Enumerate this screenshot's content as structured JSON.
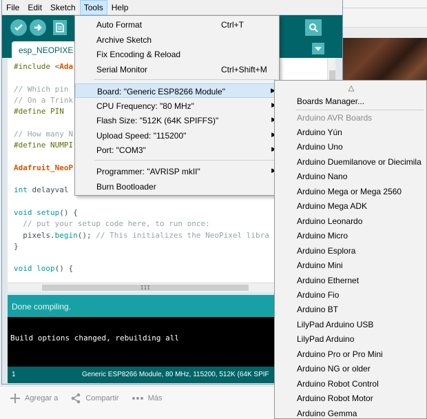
{
  "window": {
    "menubar": [
      "File",
      "Edit",
      "Sketch",
      "Tools",
      "Help"
    ],
    "active_menu": "Tools",
    "tab_name": "esp_NEOPIXE",
    "code": [
      {
        "parts": [
          {
            "t": "#include <",
            "s": "p"
          },
          {
            "t": "Ada",
            "s": "lib"
          }
        ]
      },
      {
        "parts": []
      },
      {
        "parts": [
          {
            "t": "// Which pin",
            "s": "c"
          }
        ]
      },
      {
        "parts": [
          {
            "t": "// On a Trink",
            "s": "c"
          }
        ]
      },
      {
        "parts": [
          {
            "t": "#define PIN",
            "s": "p"
          }
        ]
      },
      {
        "parts": []
      },
      {
        "parts": [
          {
            "t": "// How many N",
            "s": "c"
          }
        ]
      },
      {
        "parts": [
          {
            "t": "#define NUMPI",
            "s": "p"
          }
        ]
      },
      {
        "parts": []
      },
      {
        "parts": [
          {
            "t": "Adafruit_NeoP",
            "s": "lib"
          }
        ]
      },
      {
        "parts": []
      },
      {
        "parts": [
          {
            "t": "int",
            "s": "k"
          },
          {
            "t": " delayval",
            "s": ""
          }
        ]
      },
      {
        "parts": []
      },
      {
        "parts": [
          {
            "t": "void",
            "s": "k"
          },
          {
            "t": " ",
            "s": ""
          },
          {
            "t": "setup",
            "s": "k"
          },
          {
            "t": "() {",
            "s": ""
          }
        ]
      },
      {
        "parts": [
          {
            "t": "  // put your setup code here, to run once:",
            "s": "c"
          }
        ]
      },
      {
        "parts": [
          {
            "t": "  pixels.",
            "s": ""
          },
          {
            "t": "begin",
            "s": "k"
          },
          {
            "t": "(); ",
            "s": ""
          },
          {
            "t": "// This initializes the NeoPixel libra",
            "s": "c"
          }
        ]
      },
      {
        "parts": [
          {
            "t": "}",
            "s": ""
          }
        ]
      },
      {
        "parts": []
      },
      {
        "parts": [
          {
            "t": "void",
            "s": "k"
          },
          {
            "t": " ",
            "s": ""
          },
          {
            "t": "loop",
            "s": "k"
          },
          {
            "t": "() {",
            "s": ""
          }
        ]
      }
    ],
    "hscroll_grip": "III",
    "status": "Done compiling.",
    "console": "Build options changed, rebuilding all",
    "footer_line": "1",
    "footer_board": "Generic ESP8266 Module, 80 MHz, 115200, 512K (64K SPIF"
  },
  "tools_menu": {
    "items": [
      {
        "label": "Auto Format",
        "shortcut": "Ctrl+T"
      },
      {
        "label": "Archive Sketch",
        "shortcut": ""
      },
      {
        "label": "Fix Encoding & Reload",
        "shortcut": ""
      },
      {
        "label": "Serial Monitor",
        "shortcut": "Ctrl+Shift+M"
      },
      {
        "label": "Board: \"Generic ESP8266 Module\"",
        "shortcut": "",
        "submenu": true,
        "highlighted": true
      },
      {
        "label": "CPU Frequency: \"80 MHz\"",
        "shortcut": "",
        "submenu": true
      },
      {
        "label": "Flash Size: \"512K (64K SPIFFS)\"",
        "shortcut": "",
        "submenu": true
      },
      {
        "label": "Upload Speed: \"115200\"",
        "shortcut": "",
        "submenu": true
      },
      {
        "label": "Port: \"COM3\"",
        "shortcut": "",
        "submenu": true
      },
      {
        "label": "Programmer: \"AVRISP mkII\"",
        "shortcut": "",
        "submenu": true
      },
      {
        "label": "Burn Bootloader",
        "shortcut": ""
      }
    ]
  },
  "boards_menu": {
    "scroll_up": "△",
    "manager": "Boards Manager...",
    "category": "Arduino AVR Boards",
    "boards": [
      "Arduino Yún",
      "Arduino Uno",
      "Arduino Duemilanove or Diecimila",
      "Arduino Nano",
      "Arduino Mega or Mega 2560",
      "Arduino Mega ADK",
      "Arduino Leonardo",
      "Arduino Micro",
      "Arduino Esplora",
      "Arduino Mini",
      "Arduino Ethernet",
      "Arduino Fio",
      "Arduino BT",
      "LilyPad Arduino USB",
      "LilyPad Arduino",
      "Arduino Pro or Pro Mini",
      "Arduino NG or older",
      "Arduino Robot Control",
      "Arduino Robot Motor",
      "Arduino Gemma"
    ]
  },
  "page_actions": {
    "add": "Agregar a",
    "share": "Compartir",
    "more": "Más"
  },
  "colors": {
    "toolbar": "#006468",
    "accent": "#4db7bb",
    "status": "#17a1a5",
    "menu_highlight": "#d5e8f7"
  }
}
